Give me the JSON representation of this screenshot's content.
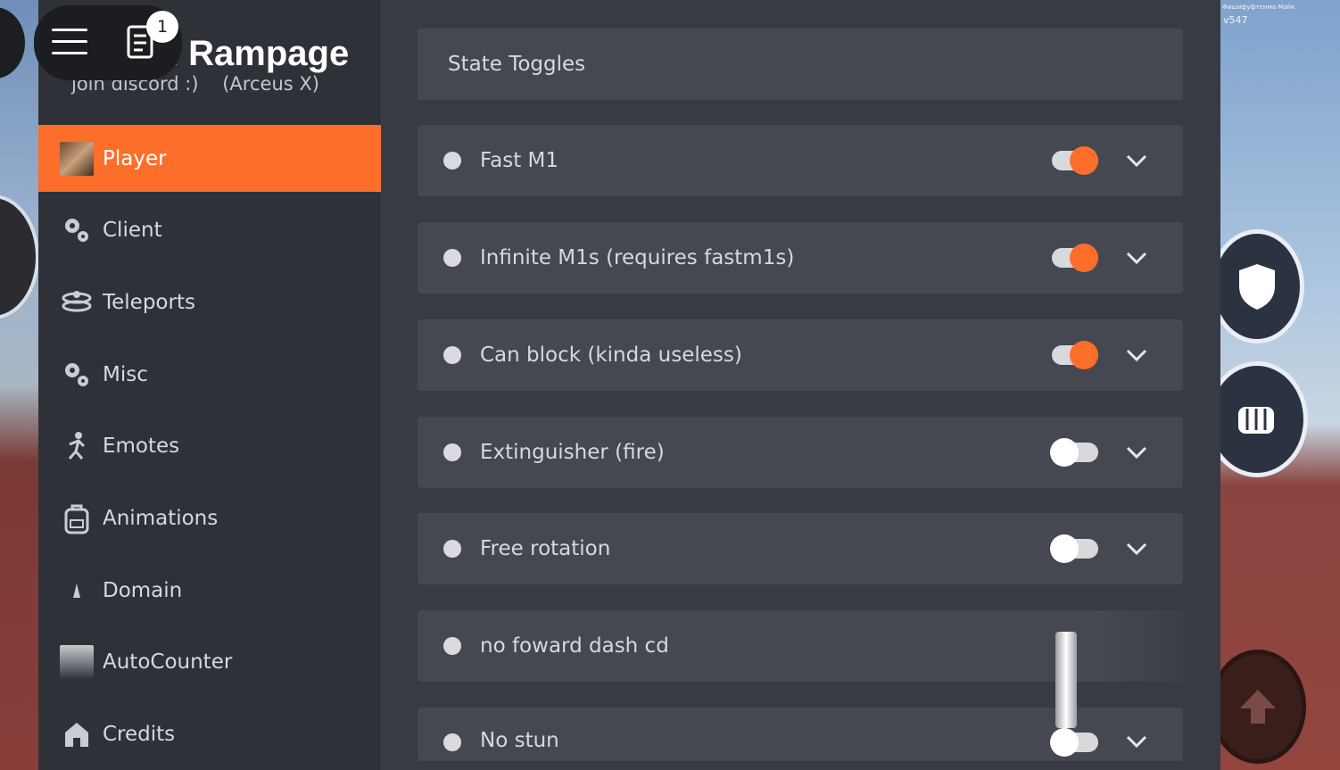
{
  "app": {
    "title": "Realm Rampage",
    "subtitle": "join discord :)    (Arceus X)",
    "notifications_count": "1",
    "version_tag": "Фишифуфтенма Майк",
    "version": "v547"
  },
  "sidebar": {
    "items": [
      {
        "label": "Player",
        "icon": "player-avatar-icon",
        "active": true
      },
      {
        "label": "Client",
        "icon": "gears-icon"
      },
      {
        "label": "Teleports",
        "icon": "teleport-icon"
      },
      {
        "label": "Misc",
        "icon": "gears-icon"
      },
      {
        "label": "Emotes",
        "icon": "running-person-icon"
      },
      {
        "label": "Animations",
        "icon": "backpack-icon"
      },
      {
        "label": "Domain",
        "icon": "small-figure-icon"
      },
      {
        "label": "AutoCounter",
        "icon": "autocounter-avatar-icon"
      },
      {
        "label": "Credits",
        "icon": "home-icon"
      }
    ]
  },
  "main": {
    "section_title": "State Toggles",
    "toggles": [
      {
        "label": "Fast M1",
        "on": true
      },
      {
        "label": "Infinite M1s (requires fastm1s)",
        "on": true
      },
      {
        "label": "Can block (kinda useless)",
        "on": true
      },
      {
        "label": "Extinguisher (fire)",
        "on": false
      },
      {
        "label": "Free rotation",
        "on": false
      },
      {
        "label": "no foward dash cd",
        "on": false
      },
      {
        "label": "No stun",
        "on": false
      }
    ]
  },
  "colors": {
    "accent": "#fc6e29",
    "sidebar_bg": "#2e3138",
    "panel_bg": "#383b43",
    "row_bg": "#454850"
  }
}
